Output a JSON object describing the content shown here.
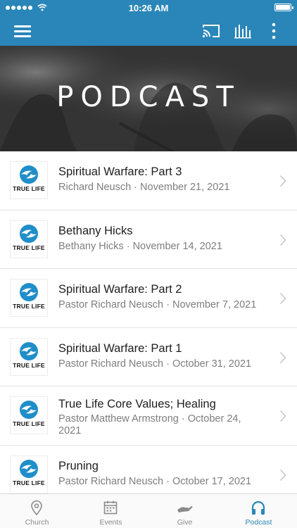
{
  "status_bar": {
    "time": "10:26 AM"
  },
  "nav": {
    "menu_icon": "hamburger-menu-icon",
    "cast_icon": "cast-icon",
    "audio_icon": "audio-bars-icon",
    "more_icon": "more-vertical-icon"
  },
  "hero": {
    "title": "PODCAST"
  },
  "logo": {
    "text": "TRUE LIFE"
  },
  "episodes": [
    {
      "title": "Spiritual Warfare: Part 3",
      "meta": "Richard Neusch · November 21, 2021"
    },
    {
      "title": "Bethany Hicks",
      "meta": "Bethany Hicks · November 14, 2021"
    },
    {
      "title": "Spiritual Warfare: Part 2",
      "meta": "Pastor Richard Neusch · November 7, 2021"
    },
    {
      "title": "Spiritual Warfare: Part 1",
      "meta": "Pastor Richard Neusch · October 31, 2021"
    },
    {
      "title": "True Life Core Values; Healing",
      "meta": "Pastor Matthew Armstrong · October 24, 2021"
    },
    {
      "title": "Pruning",
      "meta": "Pastor Richard Neusch · October 17, 2021"
    }
  ],
  "tabs": [
    {
      "label": "Church",
      "icon": "location-pin-icon"
    },
    {
      "label": "Events",
      "icon": "calendar-icon"
    },
    {
      "label": "Give",
      "icon": "giving-hand-icon"
    },
    {
      "label": "Podcast",
      "icon": "headphones-icon"
    }
  ],
  "colors": {
    "accent": "#2a86b8",
    "hero_bg": "#3a3a3a",
    "logo_blue": "#1f8ec9"
  }
}
